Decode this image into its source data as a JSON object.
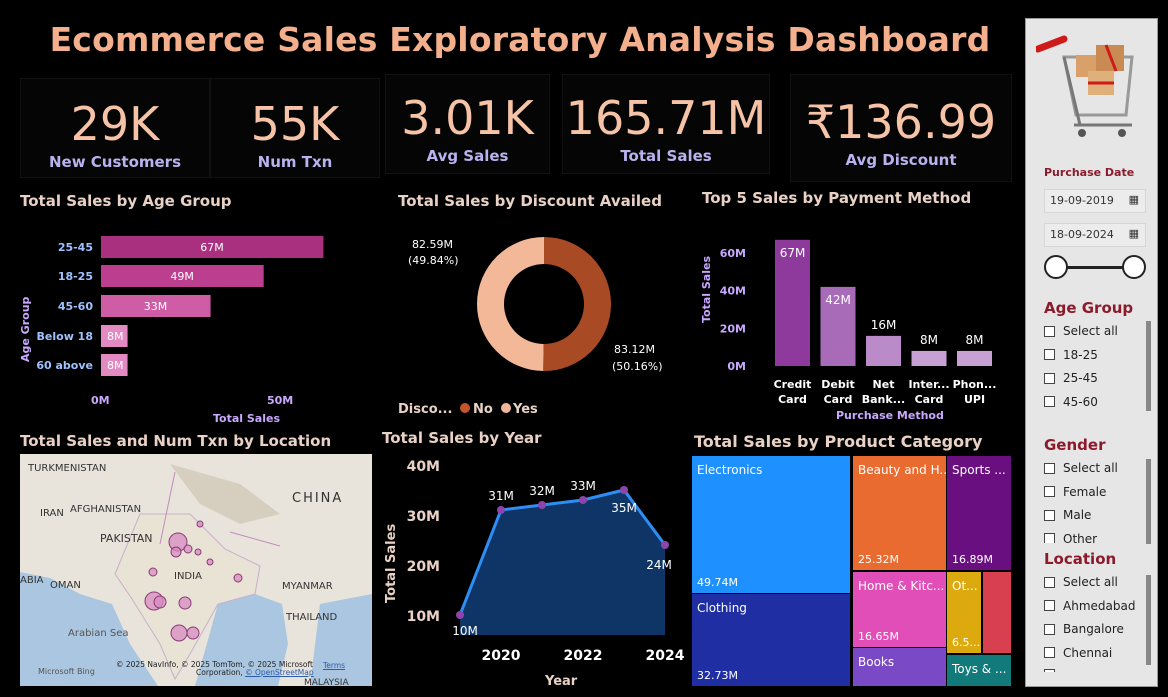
{
  "title": "Ecommerce Sales Exploratory Analysis Dashboard",
  "kpis": [
    {
      "value": "29K",
      "label": "New Customers"
    },
    {
      "value": "55K",
      "label": "Num Txn"
    },
    {
      "value": "3.01K",
      "label": "Avg Sales"
    },
    {
      "value": "165.71M",
      "label": "Total Sales"
    },
    {
      "value": "₹136.99",
      "label": "Avg Discount"
    }
  ],
  "age_chart": {
    "title": "Total Sales by Age Group",
    "ylabel": "Age Group",
    "xlabel": "Total Sales",
    "ticks": [
      "0M",
      "50M"
    ],
    "categories": [
      "25-45",
      "18-25",
      "45-60",
      "Below 18",
      "60 above"
    ],
    "values": [
      67,
      49,
      33,
      8,
      8
    ],
    "labels": [
      "67M",
      "49M",
      "33M",
      "8M",
      "8M"
    ],
    "colors": [
      "#a8307e",
      "#bb3f8e",
      "#cf5da5",
      "#e48ac3",
      "#e48ac3"
    ]
  },
  "discount_chart": {
    "title": "Total Sales by Discount Availed",
    "slices": [
      {
        "name": "No",
        "value": 82.59,
        "label": "82.59M",
        "pct": "(49.84%)",
        "color": "#f2b898"
      },
      {
        "name": "Yes",
        "value": 83.12,
        "label": "83.12M",
        "pct": "(50.16%)",
        "color": "#a84a24"
      }
    ],
    "legend_title": "Disco...",
    "legend": [
      "No",
      "Yes"
    ],
    "legend_colors": [
      "#c5542a",
      "#f0b69a"
    ]
  },
  "payment_chart": {
    "title": "Top 5 Sales by Payment Method",
    "ylabel": "Total Sales",
    "xlabel": "Purchase Method",
    "yticks": [
      "60M",
      "40M",
      "20M",
      "0M"
    ],
    "categories": [
      [
        "Credit",
        "Card"
      ],
      [
        "Debit",
        "Card"
      ],
      [
        "Net",
        "Bank..."
      ],
      [
        "Inter...",
        "Card"
      ],
      [
        "Phon...",
        "UPI"
      ]
    ],
    "values": [
      67,
      42,
      16,
      8,
      8
    ],
    "labels": [
      "67M",
      "42M",
      "16M",
      "8M",
      "8M"
    ],
    "colors": [
      "#8e3a9c",
      "#a86bb8",
      "#bb8ac9",
      "#c8a1d4",
      "#c8a1d4"
    ]
  },
  "map": {
    "title": "Total Sales and Num Txn by Location",
    "labels": {
      "turkmenistan": "TURKMENISTAN",
      "china": "CHINA",
      "iran": "IRAN",
      "afghanistan": "AFGHANISTAN",
      "pakistan": "PAKISTAN",
      "india": "INDIA",
      "oman": "OMAN",
      "abia": "ABIA",
      "myanmar": "MYANMAR",
      "thailand": "THAILAND",
      "arabian_sea": "Arabian Sea",
      "malaysia": "MALAYSIA"
    },
    "bing": "Microsoft Bing",
    "copyright": "© 2025 NavInfo, © 2025 TomTom, © 2025 Microsoft",
    "corporation": "Corporation,",
    "osm": "© OpenStreetMap",
    "terms": "Terms"
  },
  "year_chart": {
    "title": "Total Sales by Year",
    "ylabel": "Total Sales",
    "xlabel": "Year",
    "yticks": [
      "40M",
      "30M",
      "20M",
      "10M"
    ],
    "xticks": [
      "2020",
      "2022",
      "2024"
    ],
    "points": [
      {
        "year": 2019,
        "value": 10,
        "label": "10M"
      },
      {
        "year": 2020,
        "value": 31,
        "label": "31M"
      },
      {
        "year": 2021,
        "value": 32,
        "label": "32M"
      },
      {
        "year": 2022,
        "value": 33,
        "label": "33M"
      },
      {
        "year": 2023,
        "value": 35,
        "label": "35M"
      },
      {
        "year": 2024,
        "value": 24,
        "label": "24M"
      }
    ]
  },
  "treemap": {
    "title": "Total Sales by Product Category",
    "tiles": [
      {
        "name": "Electronics",
        "value": "49.74M",
        "color": "#1e90ff"
      },
      {
        "name": "Clothing",
        "value": "32.73M",
        "color": "#1f2fa3"
      },
      {
        "name": "Beauty and H...",
        "value": "25.32M",
        "color": "#e96b30"
      },
      {
        "name": "Sports ...",
        "value": "16.89M",
        "color": "#6a0f80"
      },
      {
        "name": "Home & Kitc...",
        "value": "16.65M",
        "color": "#e14eb8"
      },
      {
        "name": "Ot...",
        "value": "6.5...",
        "color": "#dcaa0e"
      },
      {
        "name": "",
        "value": "",
        "color": "#d9404f"
      },
      {
        "name": "Books",
        "value": "",
        "color": "#7a4ac6"
      },
      {
        "name": "Toys & ...",
        "value": "",
        "color": "#127a7a"
      }
    ]
  },
  "sidebar": {
    "date_title": "Purchase Date",
    "start_date": "19-09-2019",
    "end_date": "18-09-2024",
    "age": {
      "title": "Age Group",
      "options": [
        "Select all",
        "18-25",
        "25-45",
        "45-60"
      ]
    },
    "gender": {
      "title": "Gender",
      "options": [
        "Select all",
        "Female",
        "Male",
        "Other"
      ]
    },
    "location": {
      "title": "Location",
      "options": [
        "Select all",
        "Ahmedabad",
        "Bangalore",
        "Chennai",
        ""
      ]
    }
  }
}
